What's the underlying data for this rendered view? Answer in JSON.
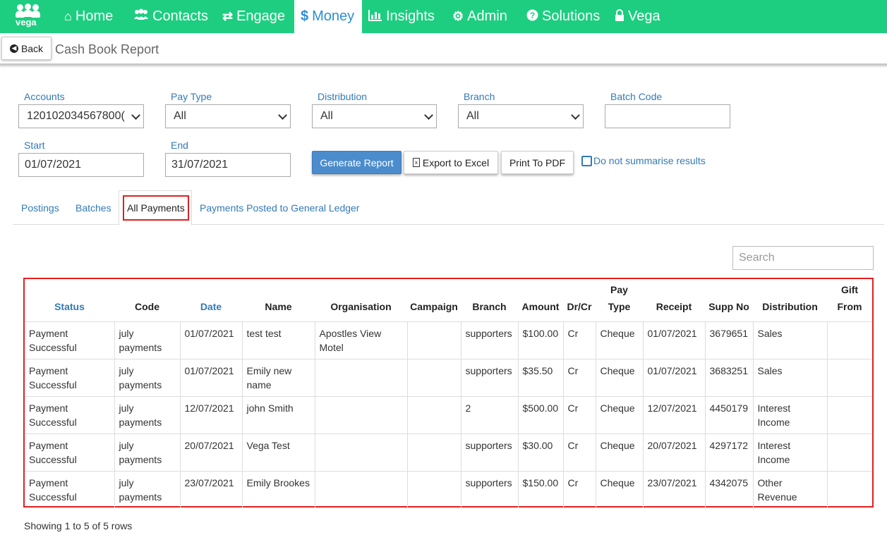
{
  "nav": {
    "logo_text": "vega",
    "items": [
      {
        "label": "Home",
        "icon": "home-icon"
      },
      {
        "label": "Contacts",
        "icon": "users-icon"
      },
      {
        "label": "Engage",
        "icon": "exchange-icon"
      },
      {
        "label": "Money",
        "icon": "dollar-icon"
      },
      {
        "label": "Insights",
        "icon": "bar-chart-icon"
      },
      {
        "label": "Admin",
        "icon": "cogs-icon"
      },
      {
        "label": "Solutions",
        "icon": "question-circle-icon"
      },
      {
        "label": "Vega",
        "icon": "lock-icon"
      }
    ],
    "active": "Money"
  },
  "header": {
    "back_label": "Back",
    "title": "Cash Book Report"
  },
  "filters": {
    "accounts_label": "Accounts",
    "accounts_value": "120102034567800(",
    "pay_type_label": "Pay Type",
    "pay_type_value": "All",
    "distribution_label": "Distribution",
    "distribution_value": "All",
    "branch_label": "Branch",
    "branch_value": "All",
    "batch_code_label": "Batch Code",
    "batch_code_value": "",
    "start_label": "Start",
    "start_value": "01/07/2021",
    "end_label": "End",
    "end_value": "31/07/2021"
  },
  "actions": {
    "generate": "Generate Report",
    "export": "Export to Excel",
    "print": "Print To PDF",
    "summarise": "Do not summarise results"
  },
  "tabs": [
    "Postings",
    "Batches",
    "All Payments",
    "Payments Posted to General Ledger"
  ],
  "active_tab": "All Payments",
  "search": {
    "placeholder": "Search"
  },
  "table": {
    "headers": {
      "status": "Status",
      "code": "Code",
      "date": "Date",
      "name": "Name",
      "organisation": "Organisation",
      "campaign": "Campaign",
      "branch": "Branch",
      "amount": "Amount",
      "drcr": "Dr/Cr",
      "paytype_1": "Pay",
      "paytype_2": "Type",
      "receipt": "Receipt",
      "suppno": "Supp No",
      "distribution": "Distribution",
      "giftfrom_1": "Gift",
      "giftfrom_2": "From"
    },
    "rows": [
      {
        "status": "Payment Successful",
        "code": "july payments",
        "date": "01/07/2021",
        "name": "test test",
        "organisation": "Apostles View Motel",
        "campaign": "",
        "branch": "supporters",
        "amount": "$100.00",
        "drcr": "Cr",
        "paytype": "Cheque",
        "receipt": "01/07/2021",
        "suppno": "3679651",
        "distribution": "Sales",
        "giftfrom": ""
      },
      {
        "status": "Payment Successful",
        "code": "july payments",
        "date": "01/07/2021",
        "name": "Emily new name",
        "organisation": "",
        "campaign": "",
        "branch": "supporters",
        "amount": "$35.50",
        "drcr": "Cr",
        "paytype": "Cheque",
        "receipt": "01/07/2021",
        "suppno": "3683251",
        "distribution": "Sales",
        "giftfrom": ""
      },
      {
        "status": "Payment Successful",
        "code": "july payments",
        "date": "12/07/2021",
        "name": "john Smith",
        "organisation": "",
        "campaign": "",
        "branch": "2",
        "amount": "$500.00",
        "drcr": "Cr",
        "paytype": "Cheque",
        "receipt": "12/07/2021",
        "suppno": "4450179",
        "distribution": "Interest Income",
        "giftfrom": ""
      },
      {
        "status": "Payment Successful",
        "code": "july payments",
        "date": "20/07/2021",
        "name": "Vega Test",
        "organisation": "",
        "campaign": "",
        "branch": "supporters",
        "amount": "$30.00",
        "drcr": "Cr",
        "paytype": "Cheque",
        "receipt": "20/07/2021",
        "suppno": "4297172",
        "distribution": "Interest Income",
        "giftfrom": ""
      },
      {
        "status": "Payment Successful",
        "code": "july payments",
        "date": "23/07/2021",
        "name": "Emily Brookes",
        "organisation": "",
        "campaign": "",
        "branch": "supporters",
        "amount": "$150.00",
        "drcr": "Cr",
        "paytype": "Cheque",
        "receipt": "23/07/2021",
        "suppno": "4342075",
        "distribution": "Other Revenue",
        "giftfrom": ""
      }
    ],
    "info": "Showing 1 to 5 of 5 rows"
  },
  "colors": {
    "nav_bg": "#1dce80",
    "link": "#337ab7",
    "primary_button": "#4b8ccc",
    "highlight_box": "#e02020"
  }
}
